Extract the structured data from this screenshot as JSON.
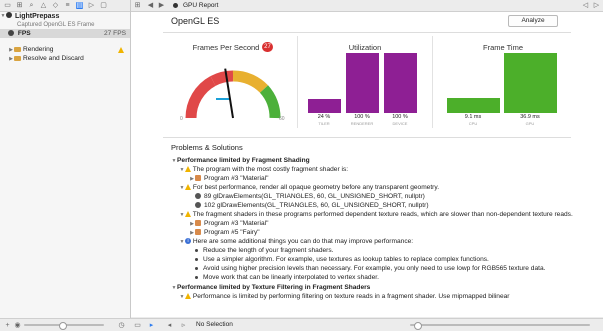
{
  "nav": {
    "app_name": "LightPrepass",
    "capture_label": "Captured OpenGL ES Frame",
    "fps_label": "FPS",
    "fps_value": "27 FPS",
    "items": [
      {
        "label": "Rendering"
      },
      {
        "label": "Resolve and Discard"
      }
    ]
  },
  "topbar": {
    "breadcrumb": "GPU Report"
  },
  "report": {
    "title": "OpenGL ES",
    "analyze_label": "Analyze",
    "fps_panel": {
      "title": "Frames Per Second",
      "badge": "27",
      "gauge_value": 27,
      "gauge_min": "0",
      "gauge_max": "60"
    },
    "utilization": {
      "title": "Utilization",
      "bars": [
        {
          "pct": "24 %",
          "name": "TILER",
          "value": 24
        },
        {
          "pct": "100 %",
          "name": "RENDERER",
          "value": 100
        },
        {
          "pct": "100 %",
          "name": "DEVICE",
          "value": 100
        }
      ],
      "color": "#8e1f94"
    },
    "frame_time": {
      "title": "Frame Time",
      "bars": [
        {
          "label": "9.1 ms",
          "name": "CPU",
          "value": 9.1
        },
        {
          "label": "36.9 ms",
          "name": "GPU",
          "value": 36.9
        }
      ],
      "color": "#4caf2a"
    }
  },
  "problems": {
    "title": "Problems & Solutions",
    "section1": "Performance limited by Fragment Shading",
    "i1": "The program with the most costly fragment shader is:",
    "i1_prog": "Program #3 \"Material\"",
    "i2": "For best performance, render all opaque geometry before any transparent geometry.",
    "i2_call1": "89 glDrawElements(GL_TRIANGLES, 60, GL_UNSIGNED_SHORT, nullptr)",
    "i2_call2": "102 glDrawElements(GL_TRIANGLES, 60, GL_UNSIGNED_SHORT, nullptr)",
    "i3": "The fragment shaders in these programs performed dependent texture reads, which are slower than non-dependent texture reads.",
    "i3_prog1": "Program #3 \"Material\"",
    "i3_prog2": "Program #5 \"Fairy\"",
    "i4": "Here are some additional things you can do that may improve performance:",
    "tips": [
      "Reduce the length of your fragment shaders.",
      "Use a simpler algorithm. For example, use textures as lookup tables to replace complex functions.",
      "Avoid using higher precision levels than necessary. For example, you only need to use lowp for RGB565 texture data.",
      "Move work that can be linearly interpolated to vertex shader."
    ],
    "section2": "Performance limited by Texture Filtering in Fragment Shaders",
    "i5": "Performance is limited by performing filtering on texture reads in a fragment shader. Use mipmapped bilinear"
  },
  "bottom": {
    "selection": "No Selection"
  }
}
